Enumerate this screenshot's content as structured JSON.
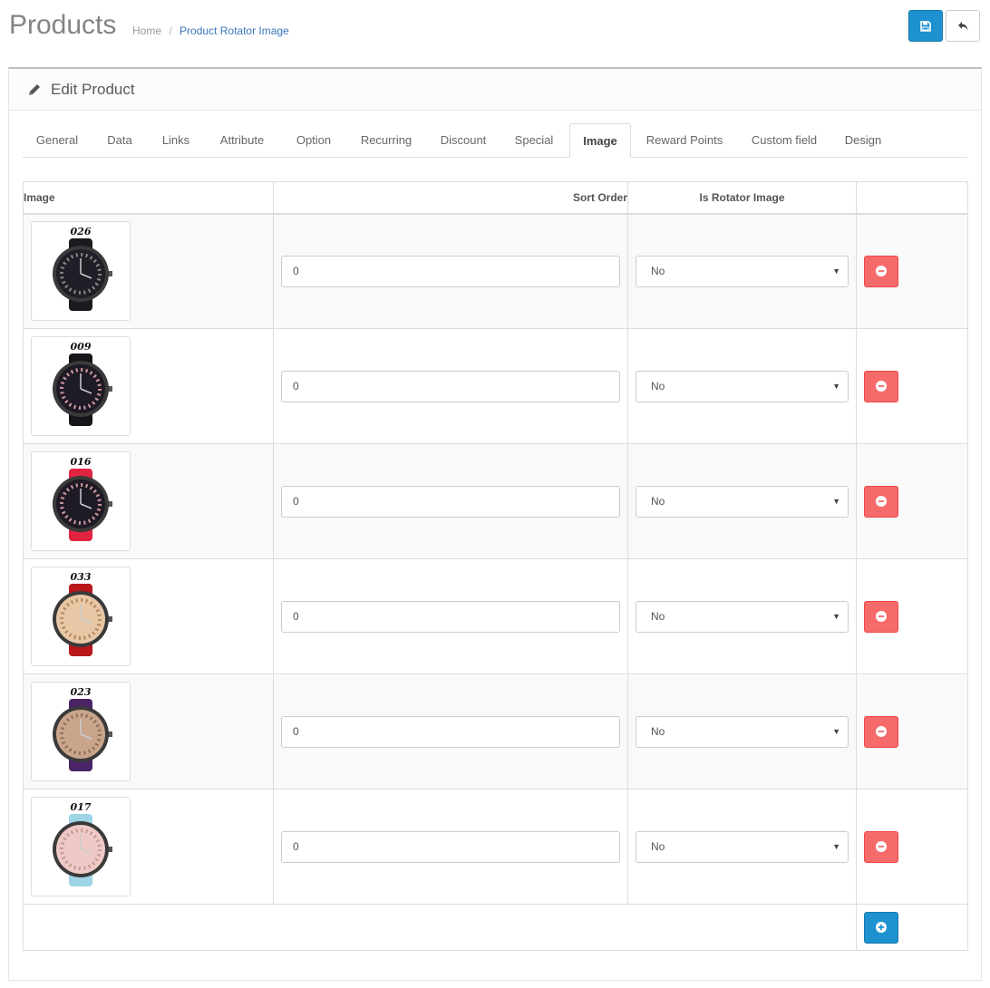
{
  "header": {
    "title": "Products",
    "breadcrumb": {
      "home": "Home",
      "separator": "/",
      "current": "Product Rotator Image"
    }
  },
  "panel": {
    "title": "Edit Product"
  },
  "tabs": [
    {
      "label": "General"
    },
    {
      "label": "Data"
    },
    {
      "label": "Links"
    },
    {
      "label": "Attribute"
    },
    {
      "label": "Option"
    },
    {
      "label": "Recurring"
    },
    {
      "label": "Discount"
    },
    {
      "label": "Special"
    },
    {
      "label": "Image",
      "active": true
    },
    {
      "label": "Reward Points"
    },
    {
      "label": "Custom field"
    },
    {
      "label": "Design"
    }
  ],
  "table": {
    "headers": {
      "image": "Image",
      "sort_order": "Sort Order",
      "is_rotator": "Is Rotator Image"
    },
    "rows": [
      {
        "code": "026",
        "strap": "#1a1a1f",
        "dial": "#1f1f27",
        "numerals": "#888888",
        "sort_order": "0",
        "is_rotator": "No"
      },
      {
        "code": "009",
        "strap": "#16161a",
        "dial": "#1e1a26",
        "numerals": "#d09aa0",
        "sort_order": "0",
        "is_rotator": "No"
      },
      {
        "code": "016",
        "strap": "#e0233f",
        "dial": "#1e1a26",
        "numerals": "#d09aa0",
        "sort_order": "0",
        "is_rotator": "No"
      },
      {
        "code": "033",
        "strap": "#b8161b",
        "dial": "#e8c7a6",
        "numerals": "#b3865e",
        "sort_order": "0",
        "is_rotator": "No"
      },
      {
        "code": "023",
        "strap": "#4a2466",
        "dial": "#c9a58c",
        "numerals": "#8f6f5c",
        "sort_order": "0",
        "is_rotator": "No"
      },
      {
        "code": "017",
        "strap": "#9ed4e6",
        "dial": "#efc9c6",
        "numerals": "#c49a98",
        "sort_order": "0",
        "is_rotator": "No"
      }
    ]
  },
  "colors": {
    "primary": "#1e91cf",
    "danger": "#f56b6b",
    "breadcrumb_link": "#3b76b9"
  },
  "icons": {
    "save": "save-icon",
    "back": "reply-icon",
    "edit": "pencil-icon",
    "remove": "minus-circle-icon",
    "add": "plus-circle-icon"
  }
}
